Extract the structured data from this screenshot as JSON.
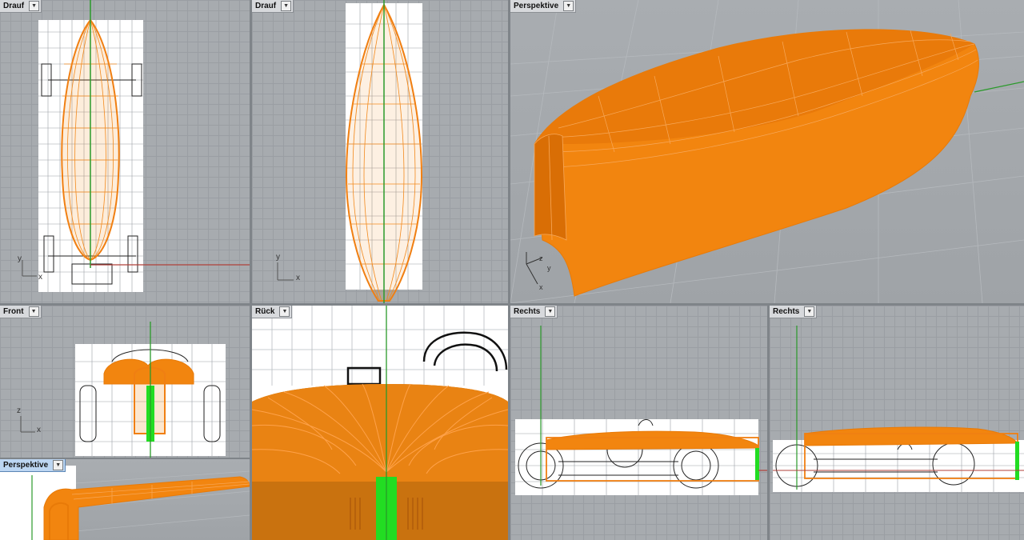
{
  "viewports": [
    {
      "name": "Drauf"
    },
    {
      "name": "Drauf"
    },
    {
      "name": "Perspektive"
    },
    {
      "name": "Front"
    },
    {
      "name": "Rück"
    },
    {
      "name": "Rechts"
    },
    {
      "name": "Rechts"
    },
    {
      "name": "Perspektive"
    }
  ],
  "axes": {
    "x": "x",
    "y": "y",
    "z": "z"
  },
  "colors": {
    "surface": "#f2850f",
    "wire": "#ff8a1a",
    "grid_line": "#9a9ea3",
    "x_axis": "#b0403a",
    "y_axis": "#2a9a2a",
    "active_tab": "#bcd6f2"
  },
  "icons": {
    "dropdown": "chevron-down-icon"
  }
}
